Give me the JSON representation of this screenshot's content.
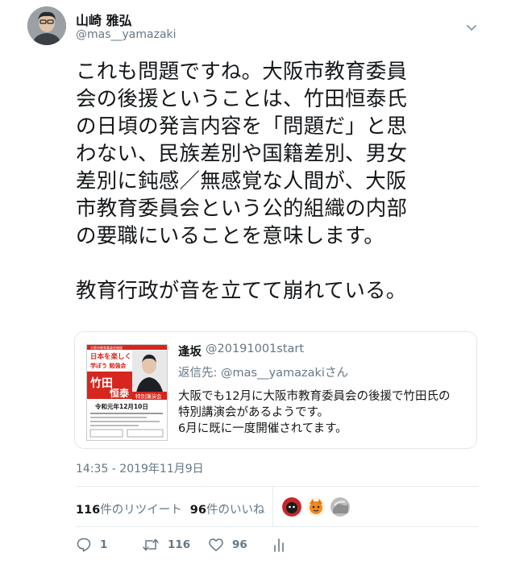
{
  "author": {
    "name": "山崎 雅弘",
    "handle": "@mas__yamazaki"
  },
  "tweet": {
    "text": "これも問題ですね。大阪市教育委員\n会の後援ということは、竹田恒泰氏\nの日頃の発言内容を「問題だ」と思\nわない、民族差別や国籍差別、男女\n差別に鈍感／無感覚な人間が、大阪\n市教育委員会という公的組織の内部\nの要職にいることを意味します。\n\n教育行政が音を立てて崩れている。"
  },
  "quote": {
    "name": "逢坂",
    "handle": "@20191001start",
    "reply_prefix": "返信先: ",
    "reply_handle": "@mas__yamazaki",
    "reply_suffix": "さん",
    "text": "大阪でも12月に大阪市教育委員会の後援で竹田氏の\n特別講演会があるようです。\n6月に既に一度開催されてます。",
    "flyer": {
      "top_small": "大阪市教育委員会後援",
      "headline_1": "日本を楽しく",
      "headline_2": "学ぼう 勉強会",
      "speaker_surname": "竹田",
      "speaker_given": "恒泰",
      "event": "特別講演会",
      "date": "令和元年12月10日"
    }
  },
  "timestamp": "14:35 - 2019年11月9日",
  "stats": {
    "retweets_num": "116",
    "retweets_label": "件のリツイート",
    "likes_num": "96",
    "likes_label": "件のいいね"
  },
  "actions": {
    "reply_count": "1",
    "retweet_count": "116",
    "like_count": "96"
  },
  "colors": {
    "text": "#14171a",
    "secondary": "#657786",
    "border": "#e1e8ed",
    "flyer_red": "#d7261e"
  }
}
